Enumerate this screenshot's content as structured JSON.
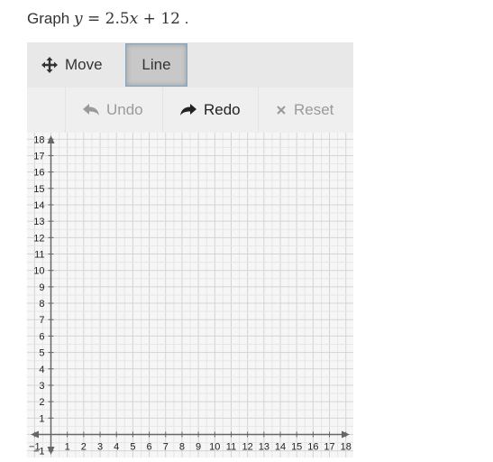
{
  "prompt": {
    "prefix": "Graph",
    "equation_lhs": "y",
    "equation_eq": " = 2.5",
    "equation_var": "x",
    "equation_rest": " + 12",
    "suffix": " ."
  },
  "toolbar": {
    "tools": [
      {
        "label": "Move",
        "icon": "move-arrows-icon",
        "selected": false
      },
      {
        "label": "Line",
        "icon": null,
        "selected": true
      }
    ],
    "actions": [
      {
        "label": "Undo",
        "icon": "undo-arrow-icon",
        "enabled": false
      },
      {
        "label": "Redo",
        "icon": "redo-arrow-icon",
        "enabled": true
      },
      {
        "label": "Reset",
        "icon": "x-icon",
        "enabled": false
      }
    ]
  },
  "chart_data": {
    "type": "scatter",
    "title": "",
    "xlabel": "",
    "ylabel": "",
    "xlim": [
      -1.5,
      18.5
    ],
    "ylim": [
      -1.5,
      18
    ],
    "grid": true,
    "minor_grid_step": 0.5,
    "x_ticks": [
      -1,
      1,
      2,
      3,
      4,
      5,
      6,
      7,
      8,
      9,
      10,
      11,
      12,
      13,
      14,
      15,
      16,
      17,
      18
    ],
    "y_ticks": [
      -1,
      1,
      2,
      3,
      4,
      5,
      6,
      7,
      8,
      9,
      10,
      11,
      12,
      13,
      14,
      15,
      16,
      17,
      18
    ],
    "series": [],
    "colors": {
      "axis": "#666666",
      "grid_major": "#d4d4d4",
      "grid_minor": "#e6e6e6"
    }
  }
}
